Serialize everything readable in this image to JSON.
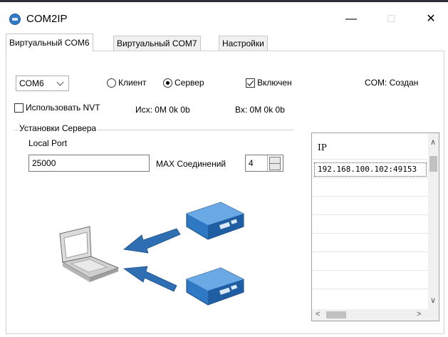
{
  "window": {
    "title": "COM2IP",
    "minimize": "—",
    "maximize": "□",
    "close": "✕"
  },
  "tabs": [
    {
      "label": "Виртуальный COM6"
    },
    {
      "label": "Виртуальный COM7"
    },
    {
      "label": "Настройки"
    }
  ],
  "top_row": {
    "port_select": "COM6",
    "radio_client": "Клиент",
    "radio_server": "Сервер",
    "server_selected": true,
    "enabled_label": "Включен",
    "enabled_checked": true,
    "com_status": "COM: Создан"
  },
  "second_row": {
    "nvt_label": "Использовать NVT",
    "nvt_checked": false,
    "out_stats": "Исх:  0M 0k 0b",
    "in_stats": "Вх:  0M 0k 0b"
  },
  "server_group": {
    "title": "Установки Сервера",
    "local_port_label": "Local Port",
    "local_port_value": "25000",
    "max_conn_label": "MAX Соединений",
    "max_conn_value": "4"
  },
  "connections": {
    "header": "IP",
    "rows": [
      "192.168.100.102:49153"
    ]
  },
  "illustration": {
    "laptop": "laptop-icon",
    "devices": [
      "serial-device-icon",
      "serial-device-icon"
    ],
    "arrow_color": "#2e6fb4",
    "device_color": "#2f78c4"
  }
}
